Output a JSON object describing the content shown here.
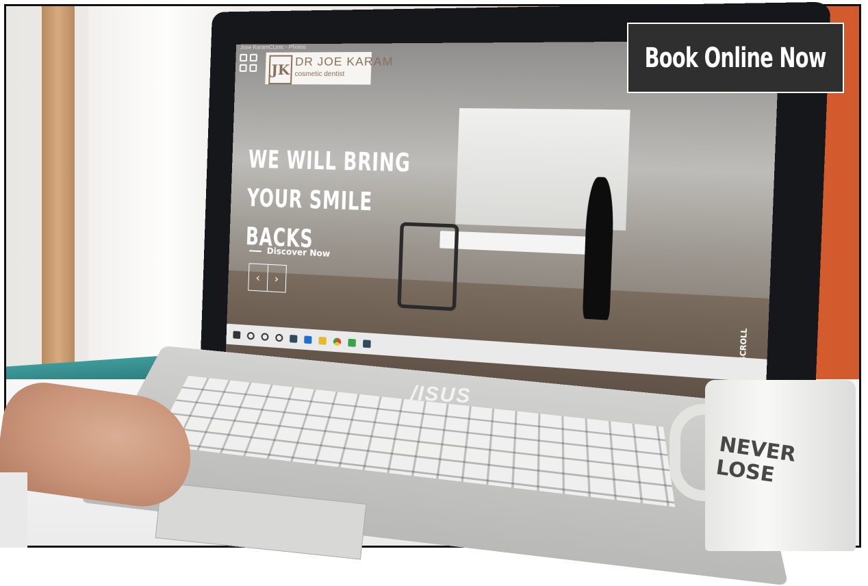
{
  "cta": {
    "label": "Book Online Now"
  },
  "website": {
    "window_title": "Jose KaramCLinic - Photos",
    "logo_mark": "JK",
    "logo_name": "DR JOE KARAM",
    "logo_tagline": "cosmetic dentist",
    "headline": "WE WILL BRING YOUR SMILE BACKS",
    "discover_link": "Discover Now",
    "scroll_label": "SCROLL",
    "prev_arrow": "‹",
    "next_arrow": "›"
  },
  "laptop": {
    "brand": "/ISUS"
  },
  "mug": {
    "text": "NEVER LOSE"
  }
}
